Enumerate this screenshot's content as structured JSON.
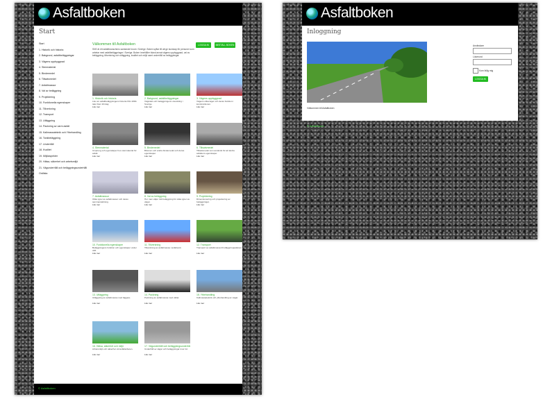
{
  "brand": {
    "name": "Asfaltboken",
    "footer": "© Asfaltboken"
  },
  "left": {
    "title": "Start",
    "nav": [
      "Start",
      "1. Historik och historia",
      "2. Bakgrund, asfaltbeläggningar",
      "3. Vägens uppbyggnad",
      "4. Stenmaterial",
      "5. Bindemedel",
      "6. Tillsatsmedel",
      "7. Asfaltmassor",
      "8. Val av beläggning",
      "9. Projektering",
      "10. Funktionella egenskaper",
      "11. Tillverkning",
      "12. Transport",
      "13. Utläggning",
      "14. Packning av varm asfalt",
      "15. Kallmassateknik och Ytbehandling",
      "16. Tankbeläggning",
      "17. Underhåll",
      "18. Kvalitet",
      "19. Miljöaspekter",
      "20. Hälsa, säkerhet och arbetsmiljö",
      "21. Vägunderhåll och beläggningsunderhåll",
      "Ordlista"
    ],
    "welcome_title": "Välkommen till Asfaltboken",
    "welcome_text": "SNS är ett asfaltbranschens samlande forum i Sverige. Boken syftar till att ge kunskap för personer som arbetar med asfaltbeläggningar i Sverige. Boken innehåller bland annat vägens uppbyggnad, val av beläggning, tillverkning och utläggning, kvalitet och miljö samt underhåll av beläggningar.",
    "login_button": "LOGGA IN",
    "register_button": "BESTÄLL BOKEN",
    "cards": [
      {
        "title": "1. Historik och historia",
        "desc": "Läs om asfaltbeläggningens historia från 1800-talet fram till idag.",
        "more": "Läs mer"
      },
      {
        "title": "2. Bakgrund, asfaltbeläggningar",
        "desc": "Vägnätet och beläggningens utveckling i Sverige.",
        "more": "Läs mer"
      },
      {
        "title": "3. Vägens uppbyggnad",
        "desc": "Vägens olika lager och deras funktion i konstruktionen.",
        "more": "Läs mer"
      },
      {
        "title": "4. Stenmaterial",
        "desc": "Ursprung och egenskaper hos stenmaterial för asfalt.",
        "more": "Läs mer"
      },
      {
        "title": "5. Bindemedel",
        "desc": "Bitumen och andra bindemedel och deras egenskaper.",
        "more": "Läs mer"
      },
      {
        "title": "6. Tillsatsmedel",
        "desc": "Tillsatsmedel som används för att ändra asfaltens egenskaper.",
        "more": "Läs mer"
      },
      {
        "title": "7. Asfaltmassor",
        "desc": "Olika typer av asfaltmassor och deras sammansättning.",
        "more": "Läs mer"
      },
      {
        "title": "8. Val av beläggning",
        "desc": "Hur man väljer rätt beläggning för olika typer av vägar.",
        "more": "Läs mer"
      },
      {
        "title": "9. Projektering",
        "desc": "Dimensionering och projektering av beläggningar.",
        "more": "Läs mer"
      },
      {
        "title": "10. Funktionella egenskaper",
        "desc": "Beläggningens funktion och egenskaper under drift.",
        "more": "Läs mer"
      },
      {
        "title": "11. Tillverkning",
        "desc": "Tillverkning av asfaltmassa i asfaltverk.",
        "more": "Läs mer"
      },
      {
        "title": "12. Transport",
        "desc": "Transport av asfaltmassa till utläggningsplatsen.",
        "more": "Läs mer"
      },
      {
        "title": "13. Utläggning",
        "desc": "Utläggning av asfaltmassa med läggare.",
        "more": "Läs mer"
      },
      {
        "title": "14. Packning",
        "desc": "Packning av asfaltmassa med vältar.",
        "more": "Läs mer"
      },
      {
        "title": "15. Ytbehandling",
        "desc": "Kallmassateknik och ytbehandling av vägar.",
        "more": "Läs mer"
      },
      {
        "title": "16. Hälsa, säkerhet och miljö",
        "desc": "Arbetsmiljö och säkerhet vid asfaltarbeten.",
        "more": "Läs mer"
      },
      {
        "title": "17. Vägunderhåll och beläggningsunderhåll",
        "desc": "Underhåll av vägar och beläggningar över tid.",
        "more": "Läs mer"
      }
    ]
  },
  "right": {
    "title": "Inloggning",
    "caption": "Välkommen till Asfaltboken",
    "username_label": "Användare",
    "password_label": "Lösenord",
    "remember_label": "Kom ihåg mig",
    "login_button": "LOGGA IN"
  }
}
